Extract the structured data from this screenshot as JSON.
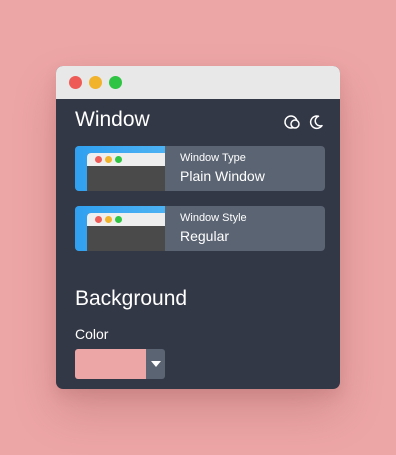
{
  "window": {
    "title": "Window",
    "theme_icons": [
      "auto-theme-icon",
      "moon-icon"
    ]
  },
  "window_type": {
    "label": "Window Type",
    "value": "Plain Window"
  },
  "window_style": {
    "label": "Window Style",
    "value": "Regular"
  },
  "background": {
    "title": "Background",
    "color_label": "Color",
    "color_value": "#eda6a6"
  },
  "colors": {
    "page_background": "#eda6a6",
    "panel": "#333846",
    "card": "#5b6473",
    "titlebar": "#e8e8e8",
    "thumb_accent": "#30a0f0"
  }
}
